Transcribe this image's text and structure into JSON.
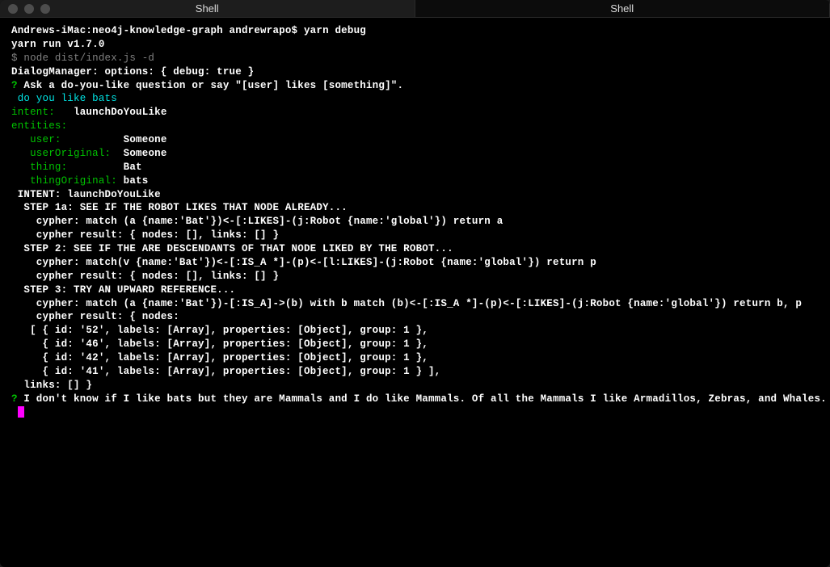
{
  "tabs": [
    {
      "label": "Shell"
    },
    {
      "label": "Shell"
    }
  ],
  "prompt": {
    "host": "Andrews-iMac:neo4j-knowledge-graph andrewrapo$ ",
    "command": "yarn debug"
  },
  "output": {
    "yarn_run": "yarn run v1.7.0",
    "node_cmd": "$ node dist/index.js -d",
    "dialog_manager": "DialogManager: options: { debug: true }",
    "question_prefix": "?",
    "question_text": " Ask a do-you-like question or say \"[user] likes [something]\".",
    "user_input": " do you like bats",
    "intent_label": "intent:",
    "intent_value": "   launchDoYouLike",
    "entities_label": "entities:",
    "entities": {
      "user_label": "   user:",
      "user_value": "          Someone",
      "userOriginal_label": "   userOriginal:",
      "userOriginal_value": "  Someone",
      "thing_label": "   thing:",
      "thing_value": "         Bat",
      "thingOriginal_label": "   thingOriginal:",
      "thingOriginal_value": " bats"
    },
    "intent_line": " INTENT: launchDoYouLike",
    "step1a": "  STEP 1a: SEE IF THE ROBOT LIKES THAT NODE ALREADY...",
    "step1a_cypher": "    cypher: match (a {name:'Bat'})<-[:LIKES]-(j:Robot {name:'global'}) return a",
    "step1a_result": "    cypher result: { nodes: [], links: [] }",
    "step2": "  STEP 2: SEE IF THE ARE DESCENDANTS OF THAT NODE LIKED BY THE ROBOT...",
    "step2_cypher": "    cypher: match(v {name:'Bat'})<-[:IS_A *]-(p)<-[l:LIKES]-(j:Robot {name:'global'}) return p",
    "step2_result": "    cypher result: { nodes: [], links: [] }",
    "step3": "  STEP 3: TRY AN UPWARD REFERENCE...",
    "step3_cypher": "    cypher: match (a {name:'Bat'})-[:IS_A]->(b) with b match (b)<-[:IS_A *]-(p)<-[:LIKES]-(j:Robot {name:'global'}) return b, p",
    "step3_result_open": "    cypher result: { nodes:",
    "node1": "   [ { id: '52', labels: [Array], properties: [Object], group: 1 },",
    "node2": "     { id: '46', labels: [Array], properties: [Object], group: 1 },",
    "node3": "     { id: '42', labels: [Array], properties: [Object], group: 1 },",
    "node4": "     { id: '41', labels: [Array], properties: [Object], group: 1 } ],",
    "links_close": "  links: [] }",
    "answer_prefix": "?",
    "answer_text": " I don't know if I like bats but they are Mammals and I do like Mammals. Of all the Mammals I like Armadillos, Zebras, and Whales."
  }
}
